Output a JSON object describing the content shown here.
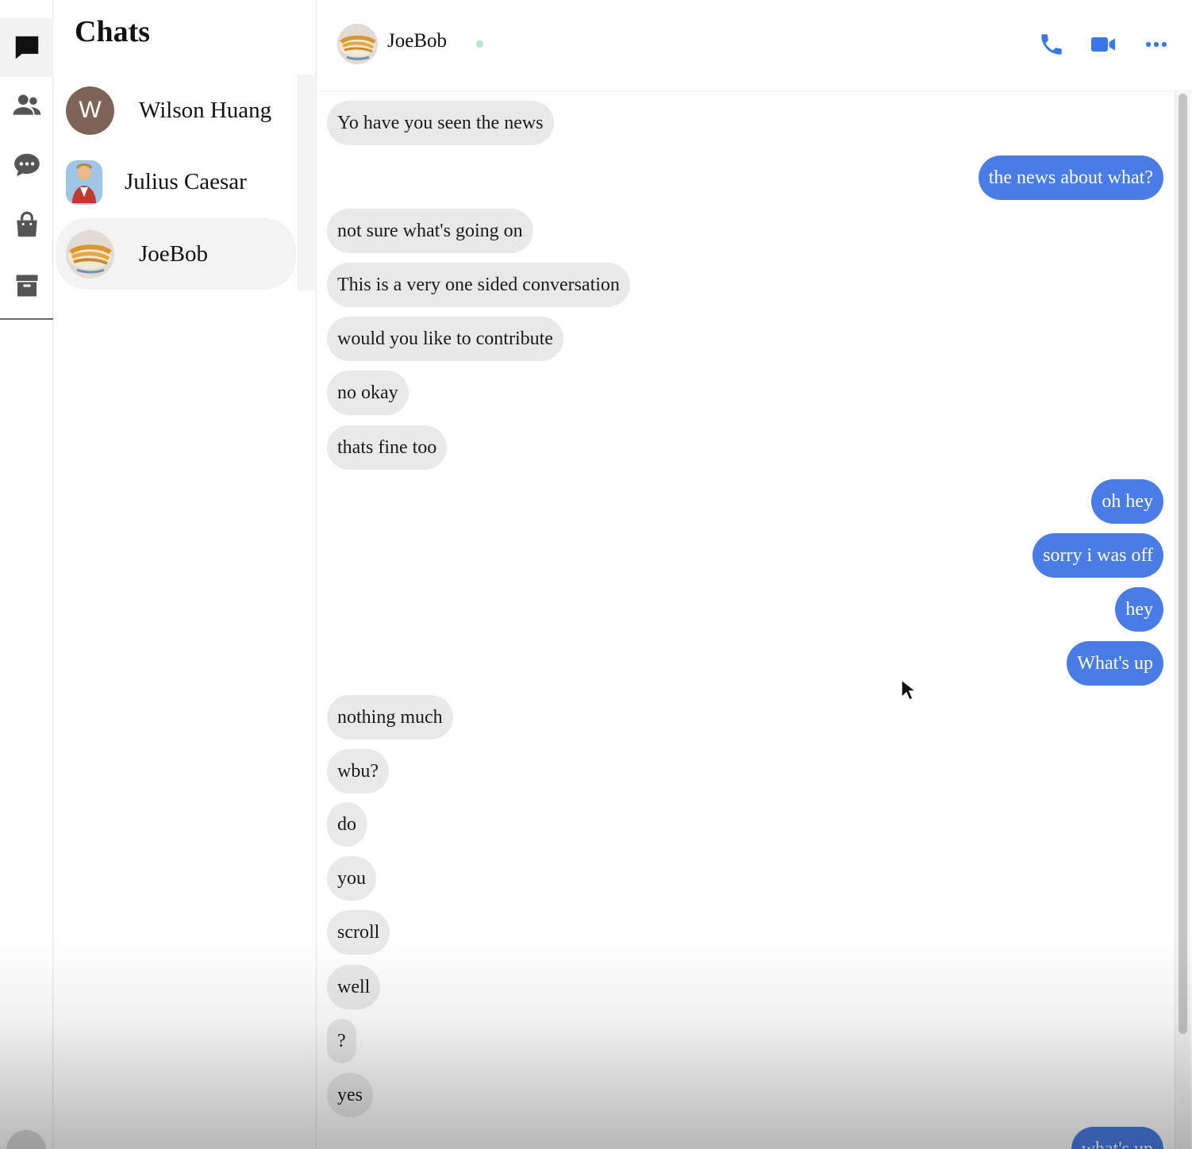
{
  "chat_list": {
    "title": "Chats",
    "contacts": [
      {
        "name": "Wilson Huang",
        "initial": "W",
        "avatar_color": "#7e6357"
      },
      {
        "name": "Julius Caesar"
      },
      {
        "name": "JoeBob",
        "active": true
      }
    ]
  },
  "rail": {
    "icons": [
      "chat-bubble-icon",
      "people-icon",
      "message-dots-icon",
      "shopping-bag-icon",
      "archive-icon"
    ]
  },
  "conversation": {
    "contact_name": "JoeBob",
    "status": "online",
    "header_icons": [
      "phone-icon",
      "video-camera-icon",
      "more-options-icon"
    ],
    "accent_color": "#4a7ce6",
    "messages": [
      {
        "text": "Yo have you seen the news",
        "from": "them"
      },
      {
        "text": "the news about what?",
        "from": "me"
      },
      {
        "text": "not sure what's going on",
        "from": "them"
      },
      {
        "text": "This is a very one sided conversation",
        "from": "them"
      },
      {
        "text": "would you like to contribute",
        "from": "them"
      },
      {
        "text": "no okay",
        "from": "them"
      },
      {
        "text": "thats fine too",
        "from": "them"
      },
      {
        "text": "oh hey",
        "from": "me"
      },
      {
        "text": "sorry i was off",
        "from": "me"
      },
      {
        "text": "hey",
        "from": "me"
      },
      {
        "text": "What's up",
        "from": "me"
      },
      {
        "text": "nothing much",
        "from": "them"
      },
      {
        "text": "wbu?",
        "from": "them"
      },
      {
        "text": "do",
        "from": "them"
      },
      {
        "text": "you",
        "from": "them"
      },
      {
        "text": "scroll",
        "from": "them"
      },
      {
        "text": "well",
        "from": "them"
      },
      {
        "text": "?",
        "from": "them"
      },
      {
        "text": "yes",
        "from": "them"
      },
      {
        "text": "what's up",
        "from": "me"
      }
    ]
  }
}
